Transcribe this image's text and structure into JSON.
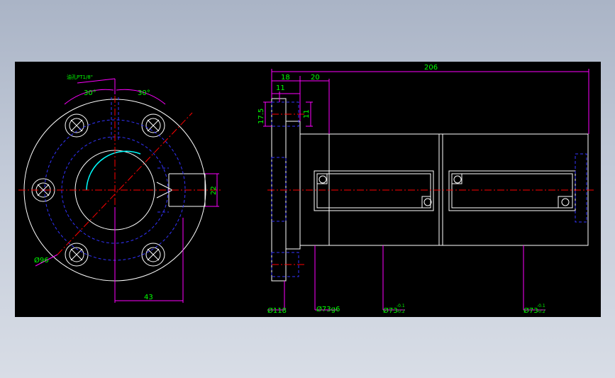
{
  "colors": {
    "background": "#000000",
    "outline": "#ffffff",
    "centerline": "#ff0000",
    "hidden": "#3333ff",
    "dimension_line": "#ff00ff",
    "dimension_text": "#00ff00",
    "bore_highlight": "#00ffff"
  },
  "front_view": {
    "note": "油孔PT1/8\"",
    "angle_left": "30°",
    "angle_right": "30°",
    "bolt_circle": "Ø96",
    "offset": "43",
    "port_width": "22"
  },
  "side_view": {
    "overall_length": "206",
    "flange_width": "18",
    "spigot_length": "20",
    "counterbore_depth": "11",
    "counterbore_dia": "11",
    "bolt_offset": "17.5",
    "flange_dia": "Ø118",
    "spigot_dia": "Ø73g6",
    "body_dia_1": "Ø73",
    "body_dia_2": "Ø73",
    "tolerance_upper": "-0.1",
    "tolerance_lower": "-0.2"
  }
}
